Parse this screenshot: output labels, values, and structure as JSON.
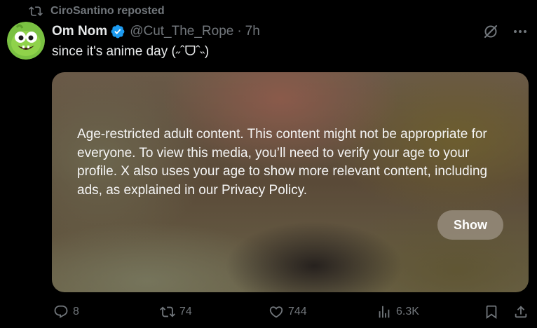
{
  "repost": {
    "icon": "repost-icon",
    "text": "CiroSantino reposted"
  },
  "author": {
    "display_name": "Om Nom",
    "handle": "@Cut_The_Rope",
    "separator": "·",
    "time": "7h",
    "verified_icon": "verified-badge-icon",
    "verified_color": "#1d9bf0",
    "avatar_color": "#7ac142"
  },
  "tweet": {
    "text": "since it's anime day (˶ˆᗜˆ˵)"
  },
  "media": {
    "warning": "Age-restricted adult content. This content might not be appropriate for everyone. To view this media, you’ll need to verify your age to your profile. X also uses your age to show more relevant content, including ads, as explained in our Privacy Policy.",
    "show_label": "Show"
  },
  "actions": {
    "replies": "8",
    "reposts": "74",
    "likes": "744",
    "views": "6.3K"
  },
  "colors": {
    "background": "#000000",
    "text_primary": "#e7e9ea",
    "text_secondary": "#71767b"
  }
}
